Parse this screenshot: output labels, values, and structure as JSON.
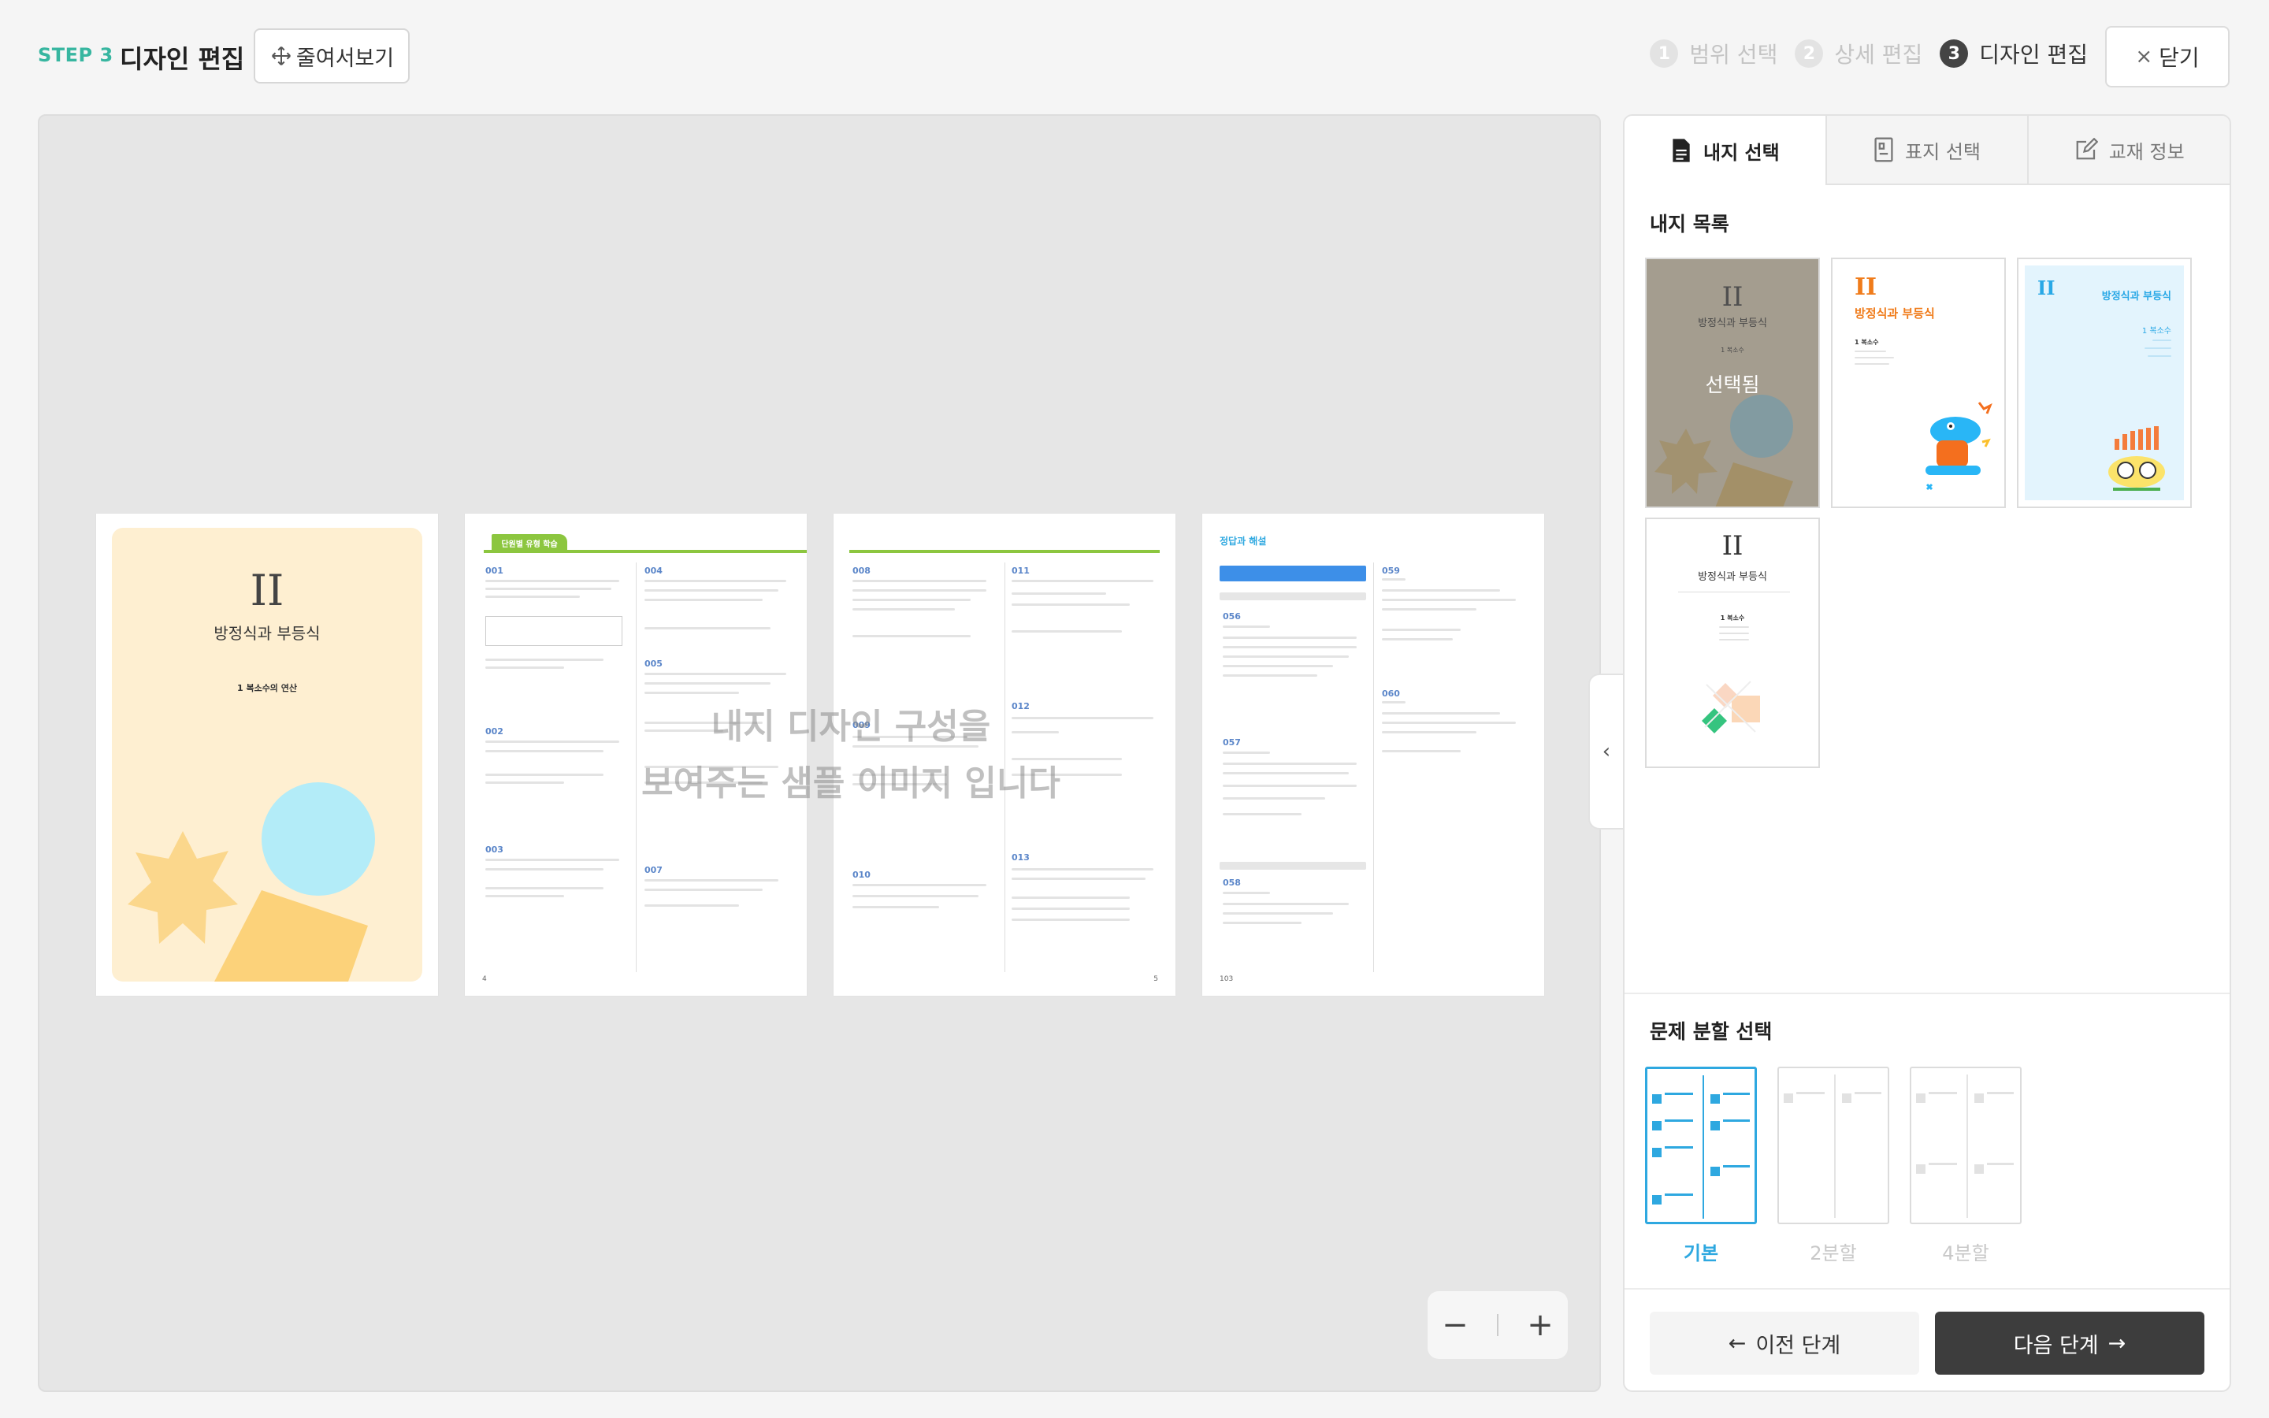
{
  "header": {
    "step_tag": "STEP 3",
    "title": "디자인 편집",
    "preview_button": "줄여서보기",
    "steps": [
      {
        "num": "1",
        "label": "범위 선택"
      },
      {
        "num": "2",
        "label": "상세 편집"
      },
      {
        "num": "3",
        "label": "디자인 편집"
      }
    ],
    "close_button": "닫기"
  },
  "preview": {
    "cover": {
      "roman": "II",
      "title": "방정식과 부등식",
      "subtitle": "1 복소수의 연산"
    },
    "page2": {
      "banner": "단원별 유형 학습",
      "footer": "4"
    },
    "page3": {
      "footer": "5"
    },
    "page4": {
      "header": "정답과 해설",
      "footer": "103"
    },
    "sample_notice_line1": "내지 디자인 구성을",
    "sample_notice_line2": "보여주는 샘플 이미지 입니다",
    "zoom_out": "−",
    "zoom_in": "+"
  },
  "panel": {
    "tabs": [
      {
        "label": "내지 선택",
        "icon": "document-icon"
      },
      {
        "label": "표지 선택",
        "icon": "cover-icon"
      },
      {
        "label": "교재 정보",
        "icon": "edit-icon"
      }
    ],
    "list_title": "내지 목록",
    "selected_label": "선택됨",
    "thumbs": [
      {
        "roman": "II",
        "title": "방정식과 부등식",
        "sub": "1 복소수"
      },
      {
        "roman": "II",
        "title": "방정식과 부등식",
        "sub": "1 복소수"
      },
      {
        "roman": "II",
        "title": "방정식과 부등식",
        "sub": "1 복소수"
      },
      {
        "roman": "II",
        "title": "방정식과 부등식",
        "sub": "1 복소수"
      }
    ],
    "split_title": "문제 분할 선택",
    "splits": [
      "기본",
      "2분할",
      "4분할"
    ],
    "prev_button": "이전 단계",
    "next_button": "다음 단계"
  },
  "colors": {
    "accent_teal": "#37b6a0",
    "accent_blue": "#2ea8e0",
    "dark_button": "#3d3d3d",
    "green_rule": "#8cc63f"
  }
}
